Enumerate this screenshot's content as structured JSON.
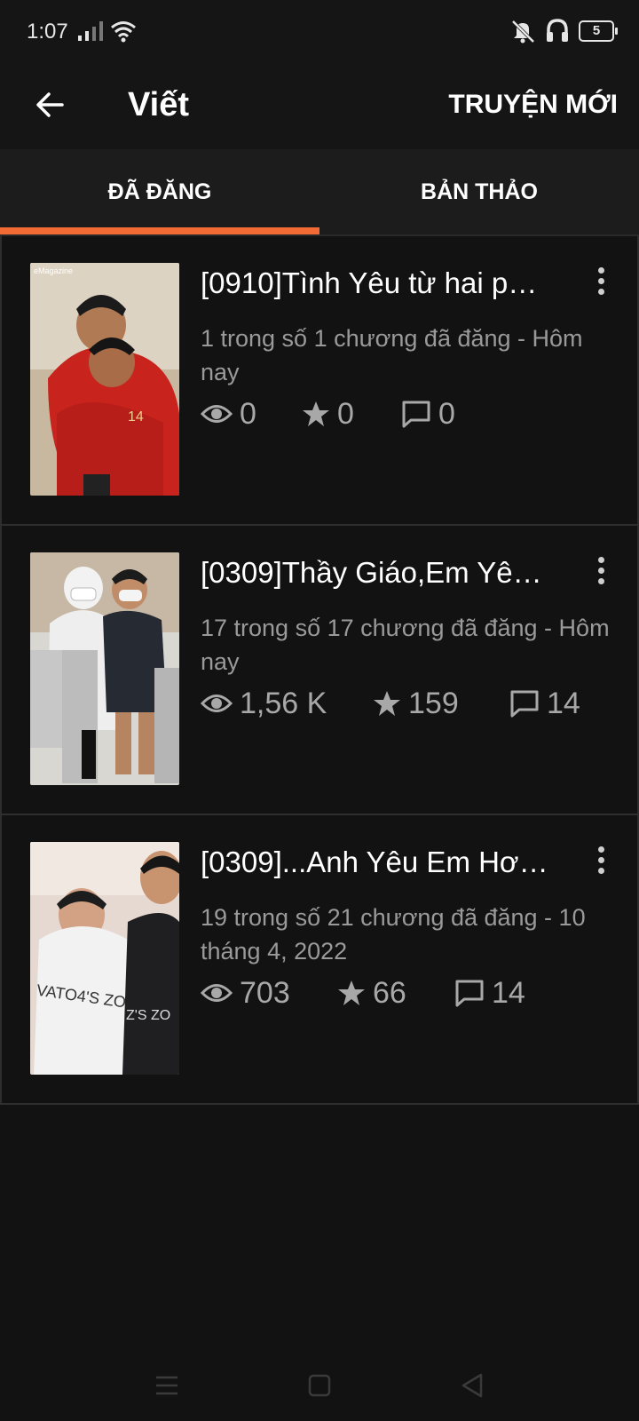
{
  "status_bar": {
    "time": "1:07",
    "battery": "5"
  },
  "app_bar": {
    "title": "Viết",
    "new_story_label": "TRUYỆN MỚI"
  },
  "tabs": [
    {
      "label": "ĐÃ ĐĂNG",
      "active": true
    },
    {
      "label": "BẢN THẢO",
      "active": false
    }
  ],
  "stories": [
    {
      "title": "[0910]Tình Yêu từ hai p…",
      "meta": "1 trong số 1 chương đã đăng - Hôm nay",
      "views": "0",
      "votes": "0",
      "comments": "0",
      "cover_text": "eMagazine"
    },
    {
      "title": "[0309]Thầy Giáo,Em Yê…",
      "meta": "17 trong số 17 chương đã đăng - Hôm nay",
      "views": "1,56 K",
      "votes": "159",
      "comments": "14"
    },
    {
      "title": "[0309]...Anh Yêu Em Hơ…",
      "meta": "19 trong số 21 chương đã đăng - 10 tháng 4, 2022",
      "views": "703",
      "votes": "66",
      "comments": "14"
    }
  ],
  "colors": {
    "accent": "#f26b34",
    "background": "#121212",
    "bar": "#151515"
  },
  "icons": [
    "back-arrow-icon",
    "eye-icon",
    "star-icon",
    "comment-icon",
    "more-vert-icon"
  ]
}
